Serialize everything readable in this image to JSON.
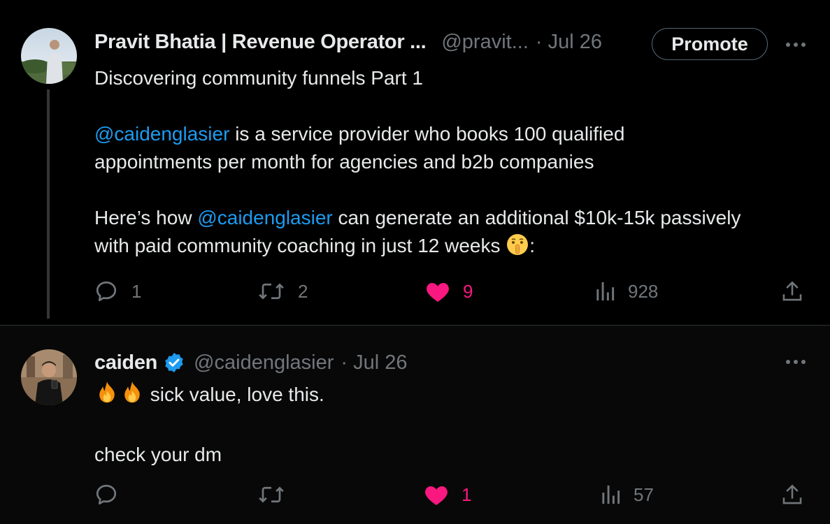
{
  "tweets": [
    {
      "author": {
        "name": "Pravit Bhatia | Revenue Operator ...",
        "handle": "@pravit...",
        "separator": "·",
        "date": "Jul 26"
      },
      "promote_label": "Promote",
      "body": {
        "line1": "Discovering community funnels Part 1",
        "mention1": "@caidenglasier",
        "text2a": " is a service provider who books 100 qualified",
        "text2b": "appointments per month for agencies and b2b companies",
        "text3a": "Here’s how ",
        "mention2": "@caidenglasier",
        "text3b": " can generate an additional $10k-15k passively",
        "text3c": "with paid community coaching in just 12 weeks ",
        "text3d": ":"
      },
      "metrics": {
        "replies": "1",
        "reposts": "2",
        "likes": "9",
        "views": "928"
      }
    },
    {
      "author": {
        "name": "caiden",
        "handle": "@caidenglasier",
        "separator": "·",
        "date": "Jul 26"
      },
      "body": {
        "line1": " sick value, love this.",
        "line2": "check your dm"
      },
      "metrics": {
        "replies": "",
        "reposts": "",
        "likes": "1",
        "views": "57"
      }
    }
  ],
  "colors": {
    "background": "#000000",
    "reply_background": "#080808",
    "text": "#e7e9ea",
    "muted": "#71767b",
    "link": "#1d9bf0",
    "like": "#f91880",
    "verified": "#1d9bf0",
    "divider": "#2f3336"
  },
  "icons": {
    "reply": "speech-bubble-icon",
    "repost": "repost-arrows-icon",
    "like": "heart-icon",
    "views": "bar-chart-icon",
    "share": "share-upload-icon",
    "more": "more-dots-icon",
    "verified": "verified-badge-icon",
    "emoji_shush": "shushing-face-emoji",
    "emoji_fire": "fire-emoji"
  }
}
